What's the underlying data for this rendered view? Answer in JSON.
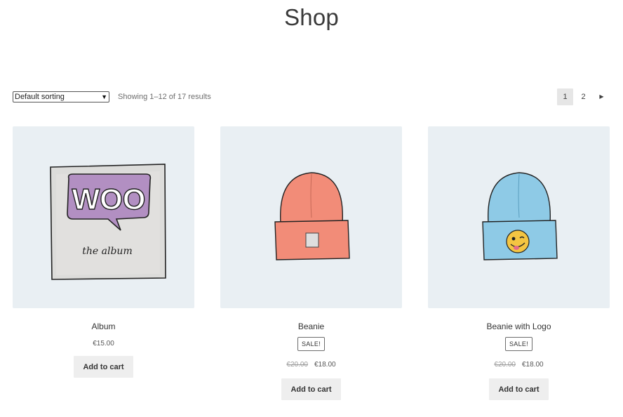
{
  "page": {
    "title": "Shop"
  },
  "toolbar": {
    "sort_value": "Default sorting",
    "result_count": "Showing 1–12 of 17 results",
    "pagination": {
      "pages": [
        "1",
        "2"
      ],
      "current": "1",
      "next_icon": "triangle-right-icon"
    }
  },
  "products": [
    {
      "title": "Album",
      "price": "€15.00",
      "button": "Add to cart",
      "image": "woo-album-cover",
      "image_text": {
        "logo": "WOO",
        "caption": "the album"
      }
    },
    {
      "title": "Beanie",
      "badge": "SALE!",
      "old_price": "€20.00",
      "price": "€18.00",
      "button": "Add to cart",
      "image": "orange-beanie"
    },
    {
      "title": "Beanie with Logo",
      "badge": "SALE!",
      "old_price": "€20.00",
      "price": "€18.00",
      "button": "Add to cart",
      "image": "blue-beanie-with-emoji"
    }
  ],
  "colors": {
    "thumb_bg": "#e9eff3",
    "button_bg": "#eeeeee",
    "woo_purple": "#b28fc2",
    "beanie_orange": "#f28c78",
    "beanie_blue": "#8ecae6",
    "emoji_yellow": "#f4c542"
  }
}
